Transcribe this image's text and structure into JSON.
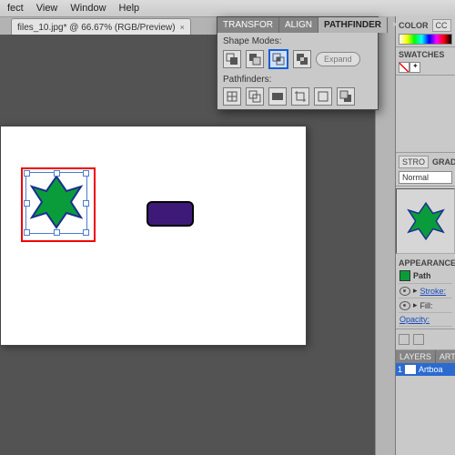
{
  "menubar": {
    "items": [
      "fect",
      "View",
      "Window",
      "Help"
    ]
  },
  "document": {
    "tab_label": "files_10.jpg* @ 66.67% (RGB/Preview)",
    "close": "×"
  },
  "floating": {
    "tabs": [
      "TRANSFOR",
      "ALIGN",
      "PATHFINDER"
    ],
    "close": "×",
    "shape_modes_label": "Shape Modes:",
    "pathfinders_label": "Pathfinders:",
    "expand": "Expand"
  },
  "right": {
    "color_tab": "COLOR",
    "color_cut": "CC",
    "swatches_label": "SWATCHES",
    "flyout": "▸",
    "stroke_tab": "STRO",
    "grad_tab": "GRAD",
    "normal": "Normal",
    "appearance_label": "APPEARANCE",
    "path": "Path",
    "stroke": "Stroke:",
    "fill": "Fill:",
    "opacity": "Opacity:",
    "layers_tab": "LAYERS",
    "artb_tab": "ART",
    "layer_num": "1",
    "layer_name": "Artboa"
  }
}
